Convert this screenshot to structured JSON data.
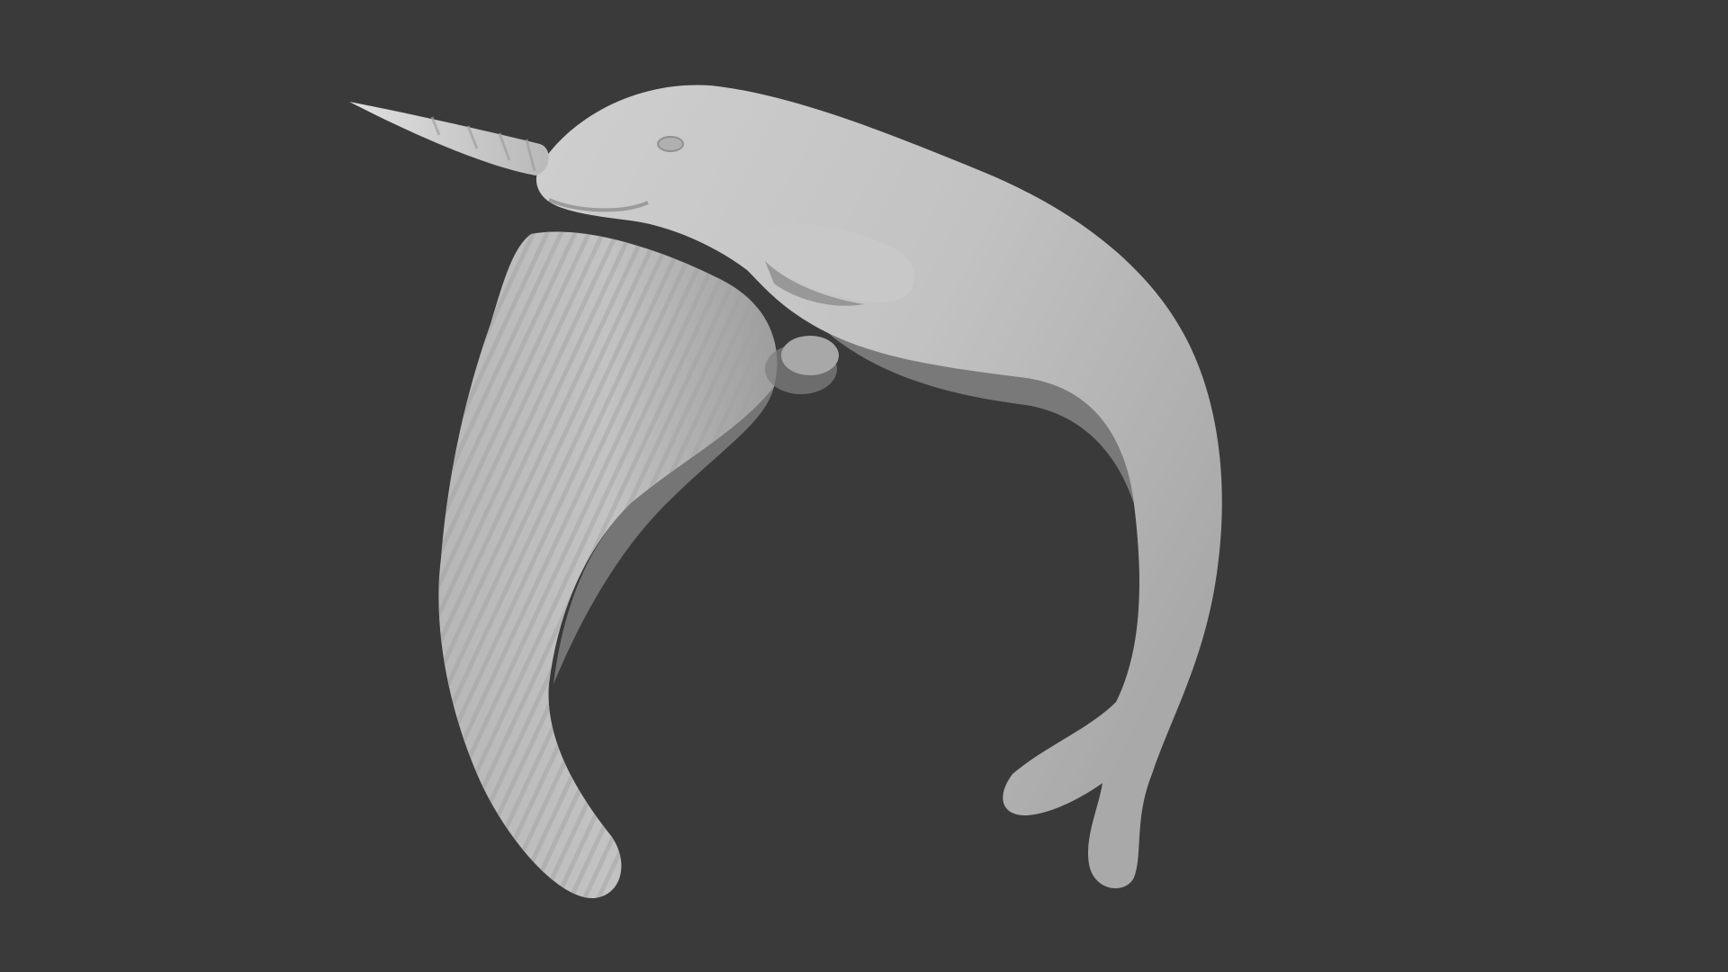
{
  "viewport": {
    "background_color": "#3a3a3b",
    "model": {
      "subject_icon": "narwhal-sculpt",
      "material_color": "#bdbdbd",
      "shadow_color": "#8a8a8a",
      "highlight_color": "#d6d6d6"
    }
  }
}
